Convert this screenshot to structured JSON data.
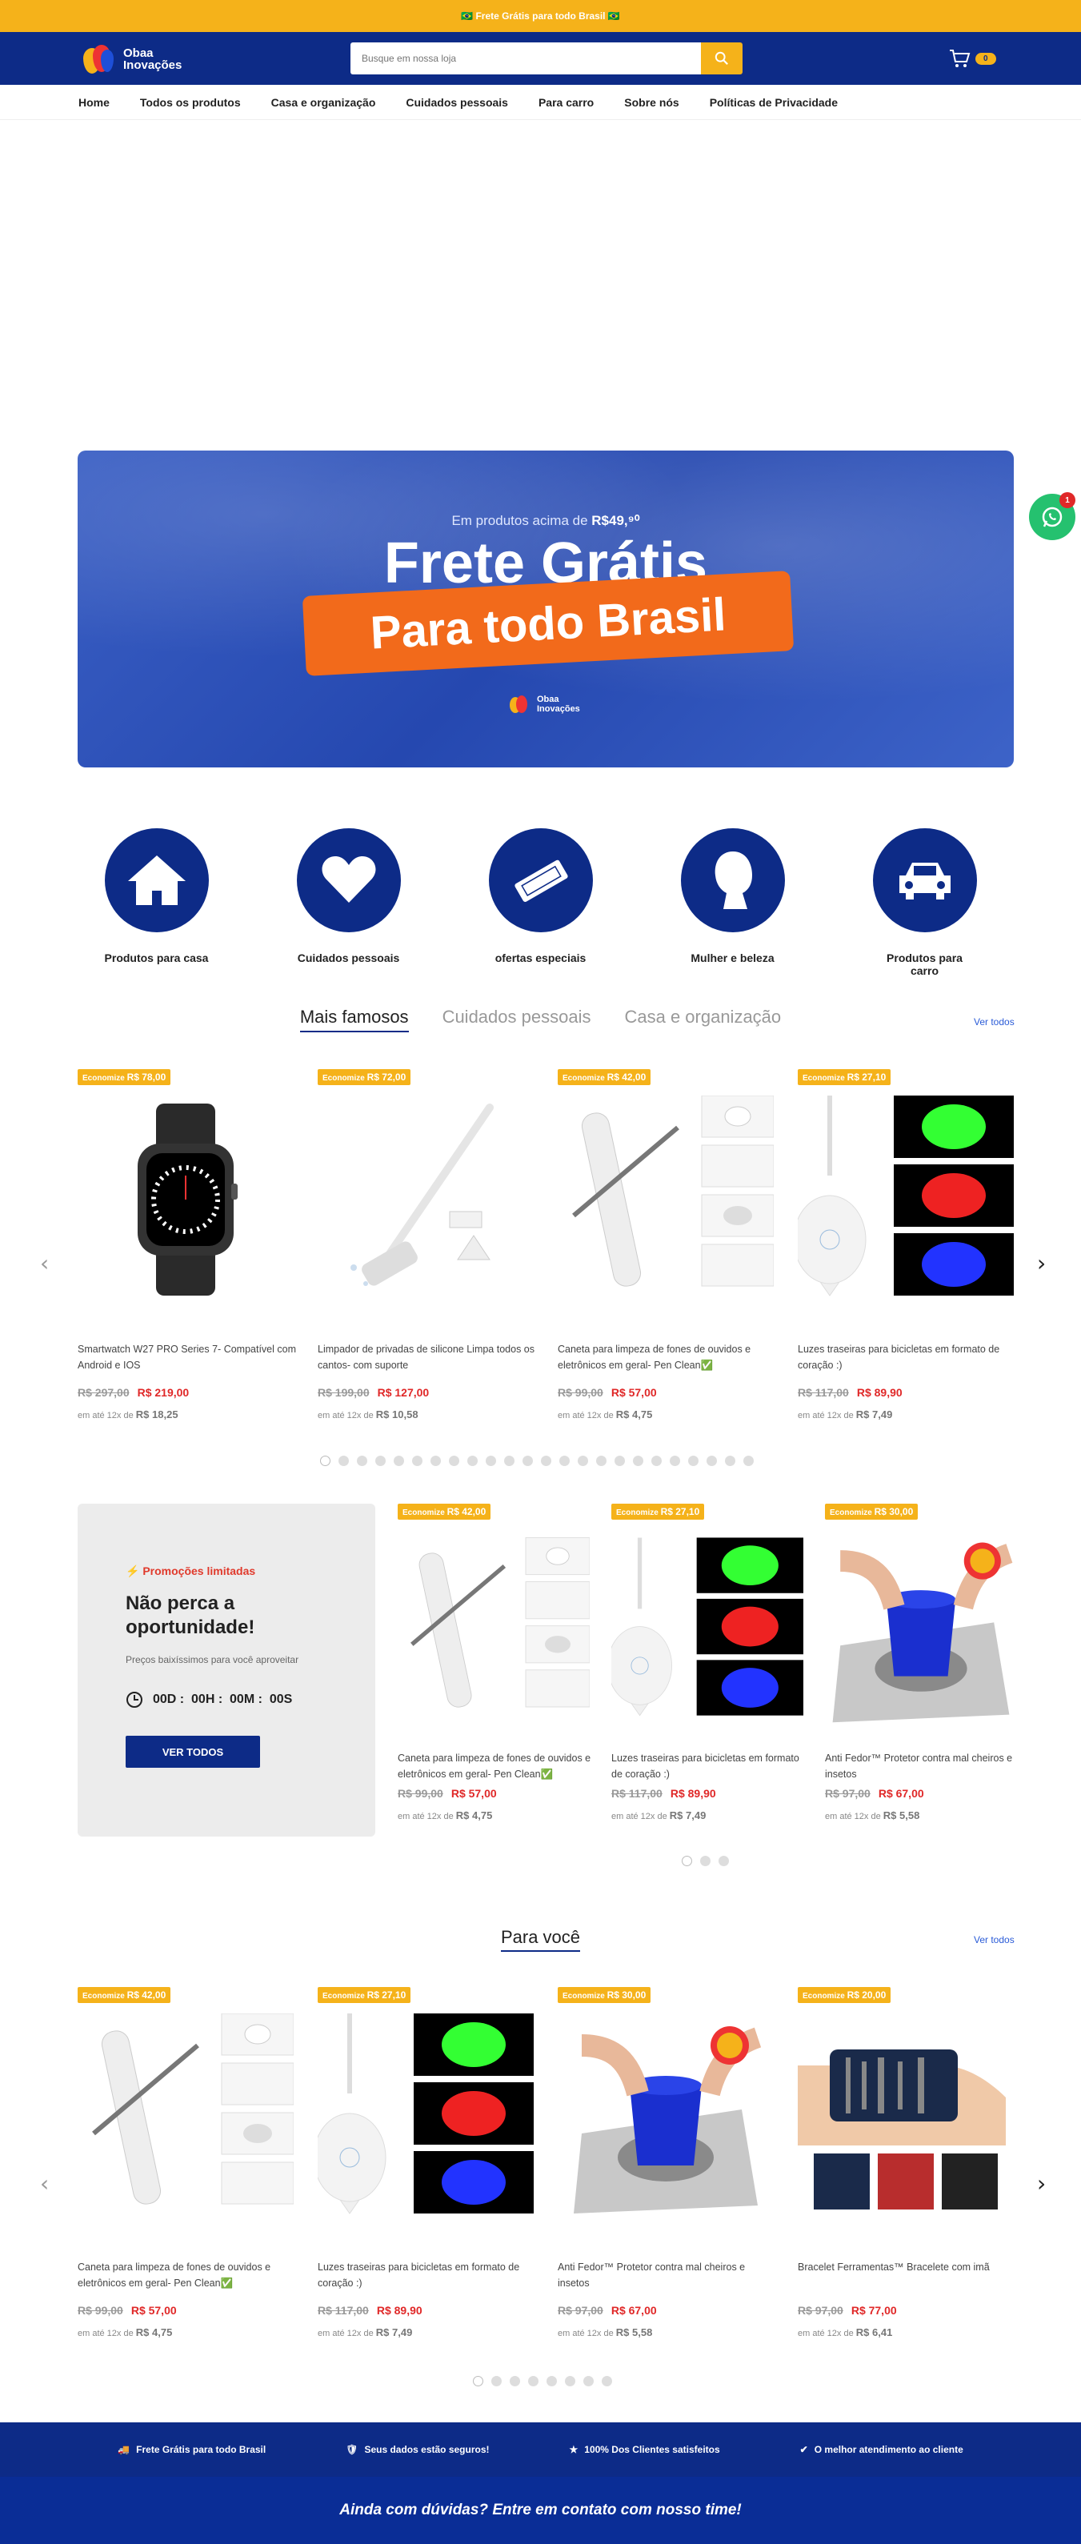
{
  "topbar": {
    "text": "🇧🇷 Frete Grátis para todo Brasil 🇧🇷"
  },
  "header": {
    "logo_line1": "Obaa",
    "logo_line2": "Inovações",
    "search_placeholder": "Busque em nossa loja",
    "cart_count": "0",
    "brand_color": "#0d2b87",
    "accent_color": "#f5b21a"
  },
  "nav": [
    "Home",
    "Todos os produtos",
    "Casa e organização",
    "Cuidados pessoais",
    "Para carro",
    "Sobre nós",
    "Políticas de Privacidade"
  ],
  "hero": {
    "subtitle_prefix": "Em produtos acima de",
    "subtitle_value": "R$49,⁹⁰",
    "title": "Frete Grátis",
    "pill": "Para todo Brasil",
    "logo_line1": "Obaa",
    "logo_line2": "Inovações"
  },
  "whatsapp": {
    "badge": "1"
  },
  "categories": [
    {
      "label": "Produtos para casa",
      "icon": "house-icon"
    },
    {
      "label": "Cuidados pessoais",
      "icon": "heart-icon"
    },
    {
      "label": "ofertas especiais",
      "icon": "ticket-icon"
    },
    {
      "label": "Mulher e beleza",
      "icon": "woman-icon"
    },
    {
      "label": "Produtos para carro",
      "icon": "car-icon"
    }
  ],
  "tabs": [
    "Mais famosos",
    "Cuidados pessoais",
    "Casa e organização"
  ],
  "see_all": "Ver todos",
  "economize": "Economize",
  "installment_prefix": "em até 12x de",
  "famous": [
    {
      "save": "R$ 78,00",
      "name": "Smartwatch W27 PRO Series 7- Compatível com Android e IOS",
      "old": "R$ 297,00",
      "new": "R$ 219,00",
      "inst": "R$ 18,25",
      "img": "watch"
    },
    {
      "save": "R$ 72,00",
      "name": "Limpador de privadas de silicone Limpa todos os cantos- com suporte",
      "old": "R$ 199,00",
      "new": "R$ 127,00",
      "inst": "R$ 10,58",
      "img": "brush"
    },
    {
      "save": "R$ 42,00",
      "name": "Caneta para limpeza de fones de ouvidos e eletrônicos em geral- Pen Clean✅",
      "old": "R$ 99,00",
      "new": "R$ 57,00",
      "inst": "R$ 4,75",
      "img": "pen"
    },
    {
      "save": "R$ 27,10",
      "name": "Luzes traseiras para bicicletas em formato de coração :)",
      "old": "R$ 117,00",
      "new": "R$ 89,90",
      "inst": "R$ 7,49",
      "img": "heart"
    }
  ],
  "promo": {
    "tag": "Promoções limitadas",
    "title": "Não perca a oportunidade!",
    "desc": "Preços baixíssimos para você aproveitar",
    "timer": "00D :  00H :  00M :  00S",
    "button": "VER TODOS"
  },
  "promo_products": [
    {
      "save": "R$ 42,00",
      "name": "Caneta para limpeza de fones de ouvidos e eletrônicos em geral- Pen Clean✅",
      "old": "R$ 99,00",
      "new": "R$ 57,00",
      "inst": "R$ 4,75",
      "img": "pen"
    },
    {
      "save": "R$ 27,10",
      "name": "Luzes traseiras para bicicletas em formato de coração :)",
      "old": "R$ 117,00",
      "new": "R$ 89,90",
      "inst": "R$ 7,49",
      "img": "heart"
    },
    {
      "save": "R$ 30,00",
      "name": "Anti Fedor™ Protetor contra mal cheiros e insetos",
      "old": "R$ 97,00",
      "new": "R$ 67,00",
      "inst": "R$ 5,58",
      "img": "drain"
    }
  ],
  "para_voce": {
    "title": "Para você"
  },
  "for_you": [
    {
      "save": "R$ 42,00",
      "name": "Caneta para limpeza de fones de ouvidos e eletrônicos em geral- Pen Clean✅",
      "old": "R$ 99,00",
      "new": "R$ 57,00",
      "inst": "R$ 4,75",
      "img": "pen"
    },
    {
      "save": "R$ 27,10",
      "name": "Luzes traseiras para bicicletas em formato de coração :)",
      "old": "R$ 117,00",
      "new": "R$ 89,90",
      "inst": "R$ 7,49",
      "img": "heart"
    },
    {
      "save": "R$ 30,00",
      "name": "Anti Fedor™ Protetor contra mal cheiros e insetos",
      "old": "R$ 97,00",
      "new": "R$ 67,00",
      "inst": "R$ 5,58",
      "img": "drain"
    },
    {
      "save": "R$ 20,00",
      "name": "Bracelet Ferramentas™ Bracelete com imã",
      "old": "R$ 97,00",
      "new": "R$ 77,00",
      "inst": "R$ 6,41",
      "img": "bracelet"
    }
  ],
  "trust": [
    "Frete Grátis para todo Brasil",
    "Seus dados estão seguros!",
    "100% Dos Clientes satisfeitos",
    "O melhor atendimento ao cliente"
  ],
  "help": "Ainda com dúvidas? Entre em contato com nosso time!"
}
